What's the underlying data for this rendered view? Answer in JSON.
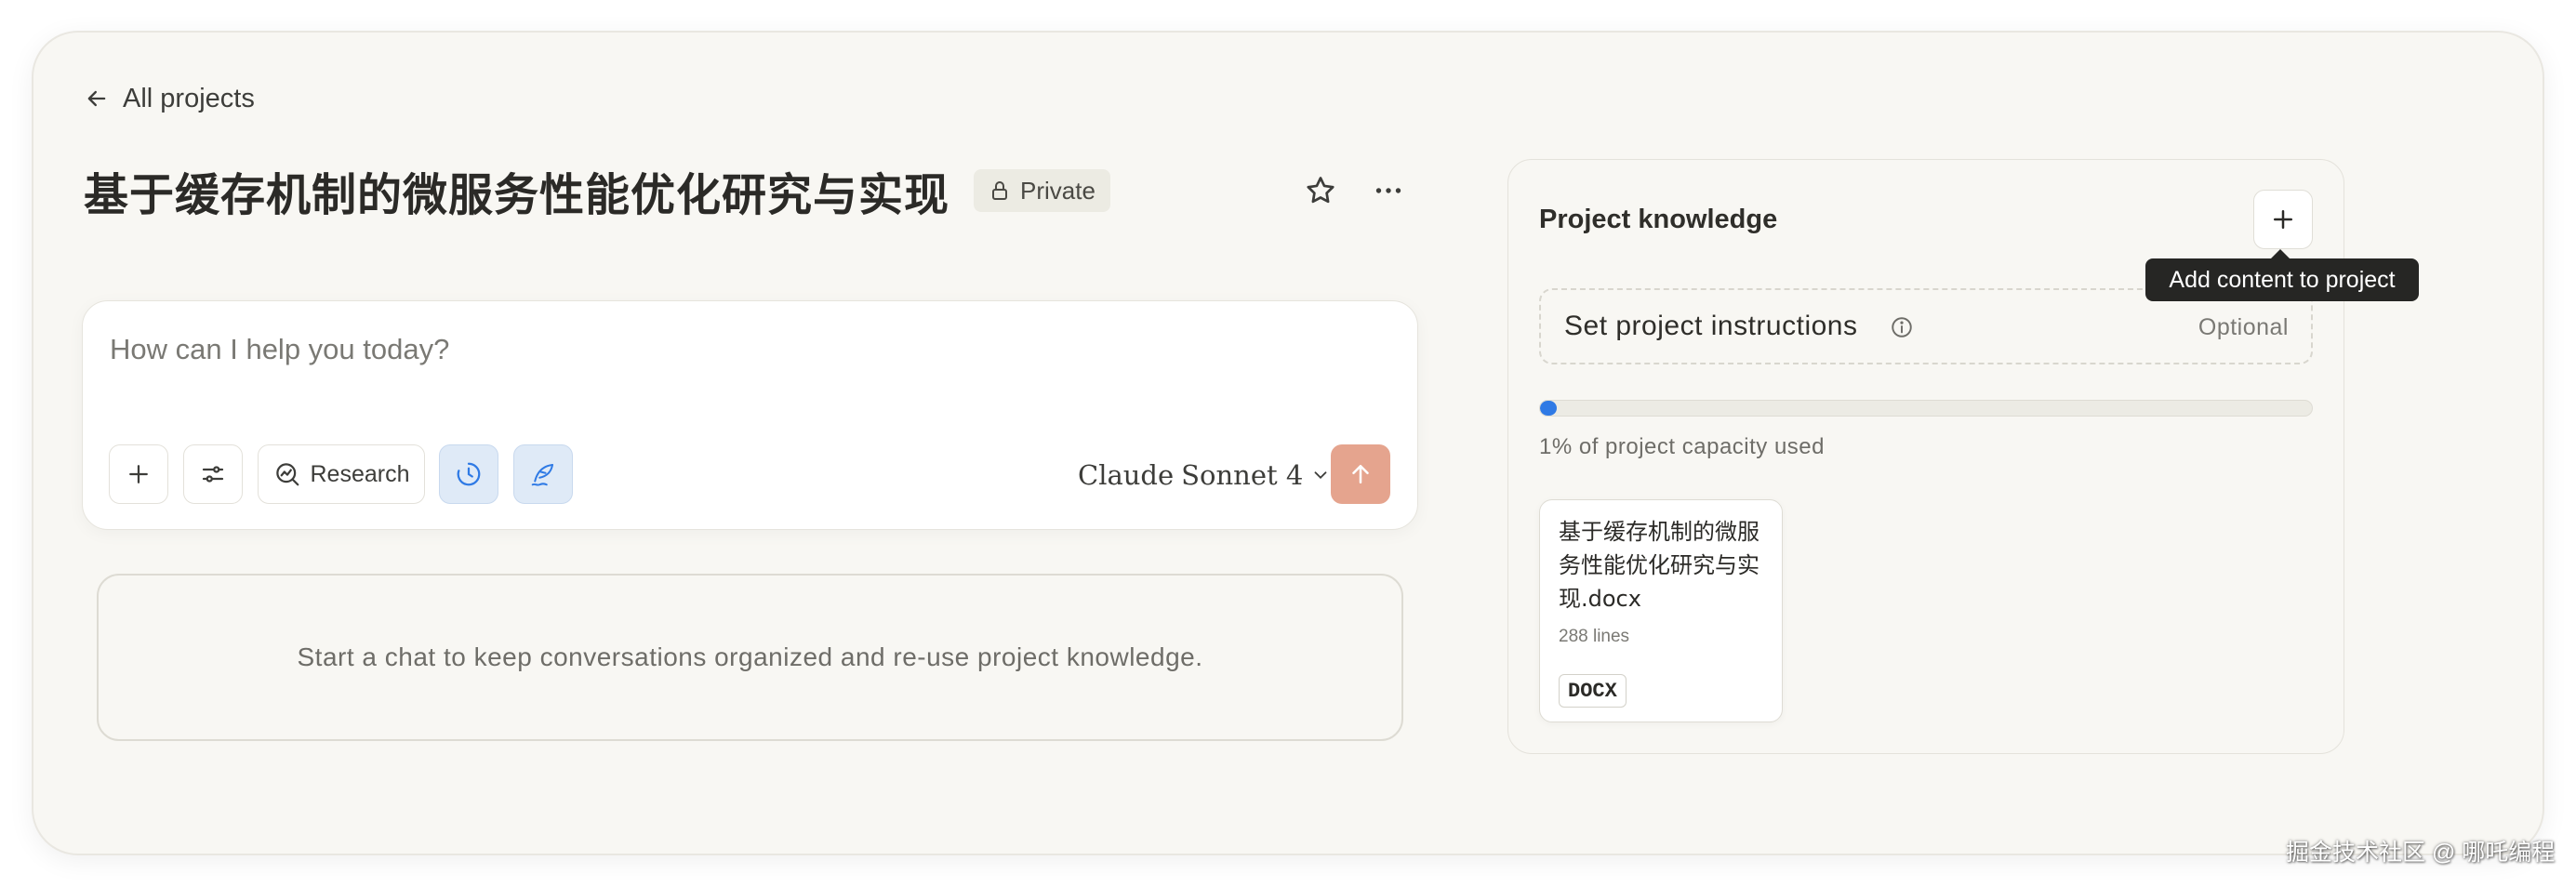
{
  "nav": {
    "back_label": "All projects"
  },
  "project": {
    "title": "基于缓存机制的微服务性能优化研究与实现",
    "privacy_badge": "Private"
  },
  "composer": {
    "placeholder": "How can I help you today?",
    "research_label": "Research",
    "model_brand": "Claude",
    "model_name": "Sonnet 4",
    "send_color": "#e5a48e"
  },
  "chats": {
    "empty_message": "Start a chat to keep conversations organized and re-use project knowledge."
  },
  "knowledge": {
    "title": "Project knowledge",
    "add_tooltip": "Add content to project",
    "instructions_label": "Set project instructions",
    "instructions_hint": "Optional",
    "capacity_percent": 1,
    "capacity_text": "1% of project capacity used",
    "files": [
      {
        "name": "基于缓存机制的微服务性能优化研究与实现.docx",
        "lines": "288 lines",
        "type": "DOCX"
      }
    ]
  },
  "watermark": "掘金技术社区 @ 哪吒编程",
  "icons": {
    "back": "arrow-left-icon",
    "lock": "lock-icon",
    "star": "star-icon",
    "more": "more-horizontal-icon",
    "plus": "plus-icon",
    "settings": "sliders-icon",
    "research": "research-icon",
    "clock": "clock-icon",
    "pen": "quill-icon",
    "chevron": "chevron-down-icon",
    "send": "arrow-up-icon",
    "info": "info-icon"
  },
  "colors": {
    "background": "#f8f7f3",
    "accent_blue": "#2f7ae5",
    "send_button": "#e5a48e"
  }
}
